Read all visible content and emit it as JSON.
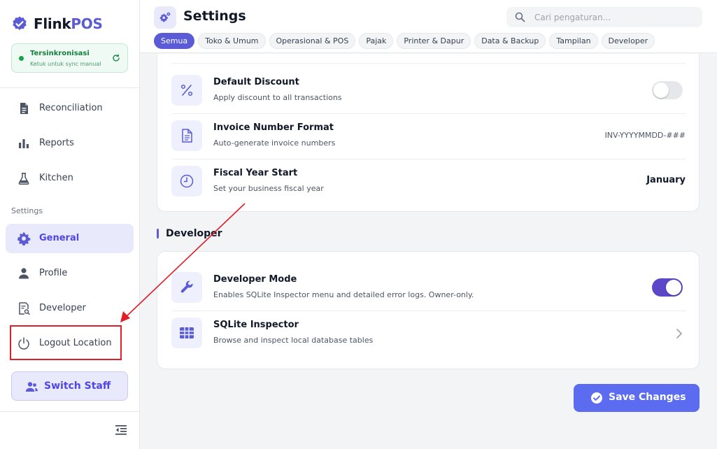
{
  "app": {
    "brand_part1": "Flink",
    "brand_part2": "POS",
    "accent_color": "#5b5bd6",
    "sync": {
      "title": "Tersinkronisasi",
      "subtitle": "Ketuk untuk sync manual"
    }
  },
  "sidebar": {
    "items": [
      {
        "label": "Reconciliation",
        "icon": "document-icon"
      },
      {
        "label": "Reports",
        "icon": "bar-chart-icon"
      },
      {
        "label": "Kitchen",
        "icon": "flask-icon"
      }
    ],
    "section_label": "Settings",
    "settings_items": [
      {
        "label": "General",
        "icon": "gear-icon",
        "active": true
      },
      {
        "label": "Profile",
        "icon": "user-icon"
      },
      {
        "label": "Developer",
        "icon": "code-search-icon"
      },
      {
        "label": "Logout Location",
        "icon": "power-icon"
      }
    ],
    "switch_staff": "Switch Staff"
  },
  "header": {
    "title": "Settings",
    "search_placeholder": "Cari pengaturan...",
    "tabs": [
      {
        "label": "Semua",
        "active": true
      },
      {
        "label": "Toko & Umum"
      },
      {
        "label": "Operasional & POS"
      },
      {
        "label": "Pajak"
      },
      {
        "label": "Printer & Dapur"
      },
      {
        "label": "Data & Backup"
      },
      {
        "label": "Tampilan"
      },
      {
        "label": "Developer"
      }
    ]
  },
  "general_rows": [
    {
      "title": "Default Discount",
      "desc": "Apply discount to all transactions",
      "control": "toggle",
      "enabled": false,
      "icon": "percent-icon"
    },
    {
      "title": "Invoice Number Format",
      "desc": "Auto-generate invoice numbers",
      "value": "INV-YYYYMMDD-###",
      "icon": "file-icon"
    },
    {
      "title": "Fiscal Year Start",
      "desc": "Set your business fiscal year",
      "value": "January",
      "icon": "clock-icon"
    }
  ],
  "developer_section": {
    "heading": "Developer",
    "rows": [
      {
        "title": "Developer Mode",
        "desc": "Enables SQLite Inspector menu and detailed error logs. Owner-only.",
        "control": "toggle",
        "enabled": true,
        "icon": "wrench-icon"
      },
      {
        "title": "SQLite Inspector",
        "desc": "Browse and inspect local database tables",
        "control": "chevron",
        "icon": "table-icon"
      }
    ]
  },
  "save_label": "Save Changes",
  "annotation_color": "#e11d28"
}
